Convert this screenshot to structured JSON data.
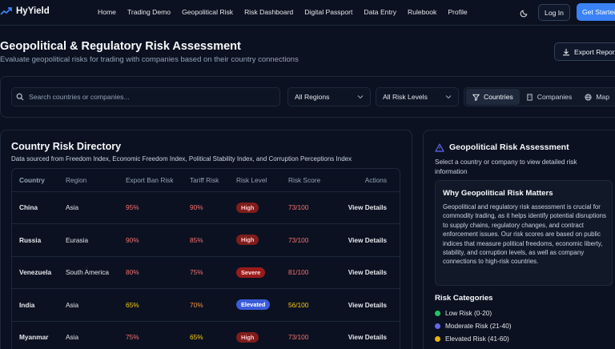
{
  "nav": {
    "brand": "HyYield",
    "links": [
      "Home",
      "Trading Demo",
      "Geopolitical Risk",
      "Risk Dashboard",
      "Digital Passport",
      "Data Entry",
      "Rulebook",
      "Profile"
    ],
    "login": "Log In",
    "get_started": "Get Started"
  },
  "header": {
    "title": "Geopolitical & Regulatory Risk Assessment",
    "subtitle": "Evaluate geopolitical risks for trading with companies based on their country connections",
    "export": "Export Report"
  },
  "filters": {
    "search_placeholder": "Search countries or companies...",
    "region": "All Regions",
    "risk_level": "All Risk Levels",
    "views": [
      "Countries",
      "Companies",
      "Map"
    ],
    "active_view": "Countries"
  },
  "directory": {
    "title": "Country Risk Directory",
    "subtitle": "Data sourced from Freedom Index, Economic Freedom Index, Political Stability Index, and Corruption Perceptions Index",
    "columns": [
      "Country",
      "Region",
      "Export Ban Risk",
      "Tariff Risk",
      "Risk Level",
      "Risk Score",
      "Actions"
    ],
    "rows": [
      {
        "country": "China",
        "region": "Asia",
        "export": "95%",
        "tariff": "90%",
        "level": "High",
        "score": "73/100",
        "action": "View Details"
      },
      {
        "country": "Russia",
        "region": "Eurasia",
        "export": "90%",
        "tariff": "85%",
        "level": "High",
        "score": "73/100",
        "action": "View Details"
      },
      {
        "country": "Venezuela",
        "region": "South America",
        "export": "80%",
        "tariff": "75%",
        "level": "Severe",
        "score": "81/100",
        "action": "View Details"
      },
      {
        "country": "India",
        "region": "Asia",
        "export": "65%",
        "tariff": "70%",
        "level": "Elevated",
        "score": "56/100",
        "action": "View Details"
      },
      {
        "country": "Myanmar",
        "region": "Asia",
        "export": "75%",
        "tariff": "65%",
        "level": "High",
        "score": "73/100",
        "action": "View Details"
      }
    ]
  },
  "side": {
    "title": "Geopolitical Risk Assessment",
    "subtitle": "Select a country or company to view detailed risk information",
    "why_title": "Why Geopolitical Risk Matters",
    "why_text": "Geopolitical and regulatory risk assessment is crucial for commodity trading, as it helps identify potential disruptions to supply chains, regulatory changes, and contract enforcement issues. Our risk scores are based on public indices that measure political freedoms, economic liberty, stability, and corruption levels, as well as company connections to high-risk countries.",
    "categories_title": "Risk Categories",
    "categories": [
      {
        "label": "Low Risk (0-20)",
        "color": "#22c55e"
      },
      {
        "label": "Moderate Risk (21-40)",
        "color": "#6366f1"
      },
      {
        "label": "Elevated Risk (41-60)",
        "color": "#eab308"
      }
    ]
  },
  "colors": {
    "accent": "#3b82f6",
    "high_badge_bg": "#7f1d1d",
    "high_badge_text": "#fecaca",
    "severe_badge_bg": "#991b1b",
    "elevated_badge_bg": "#3b5bdb",
    "pct_red": "#f87171",
    "pct_orange": "#fb923c",
    "pct_yellow": "#facc15"
  }
}
